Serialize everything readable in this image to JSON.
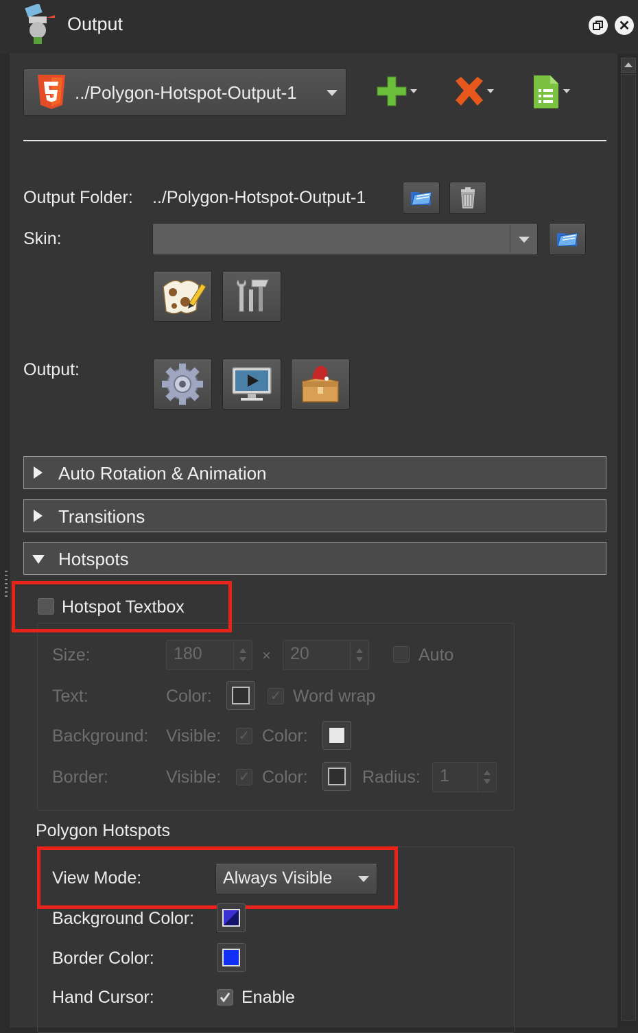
{
  "window": {
    "title": "Output"
  },
  "toolbar": {
    "target_label": "../Polygon-Hotspot-Output-1"
  },
  "output_folder": {
    "label": "Output Folder:",
    "value": "../Polygon-Hotspot-Output-1"
  },
  "skin": {
    "label": "Skin:",
    "value": ""
  },
  "output": {
    "label": "Output:"
  },
  "sections": {
    "auto_rotation": "Auto Rotation & Animation",
    "transitions": "Transitions",
    "hotspots": "Hotspots"
  },
  "hotspot_textbox": {
    "label": "Hotspot Textbox",
    "checked": false,
    "size_label": "Size:",
    "width": "180",
    "times": "×",
    "height": "20",
    "auto_label": "Auto",
    "text_label": "Text:",
    "color_label": "Color:",
    "word_wrap_label": "Word wrap",
    "background_label": "Background:",
    "visible_label": "Visible:",
    "border_label": "Border:",
    "radius_label": "Radius:",
    "radius_value": "1"
  },
  "polygon_hotspots": {
    "title": "Polygon Hotspots",
    "view_mode_label": "View Mode:",
    "view_mode_value": "Always Visible",
    "background_color_label": "Background Color:",
    "border_color_label": "Border Color:",
    "hand_cursor_label": "Hand Cursor:",
    "enable_label": "Enable",
    "enable_checked": true
  },
  "colors": {
    "html5_orange": "#e44d26",
    "add_green": "#6bbf3a",
    "remove_orange": "#e8571c",
    "doc_green": "#7cc242",
    "highlight_red": "#e8231a",
    "polygon_border_blue": "#1230f5"
  },
  "icons": [
    "app-icon",
    "restore-icon",
    "close-icon",
    "html5-icon",
    "add-icon",
    "remove-icon",
    "document-icon",
    "folder-open-icon",
    "trash-icon",
    "skin-editor-icon",
    "tools-icon",
    "settings-gear-icon",
    "preview-monitor-icon",
    "package-box-icon"
  ]
}
